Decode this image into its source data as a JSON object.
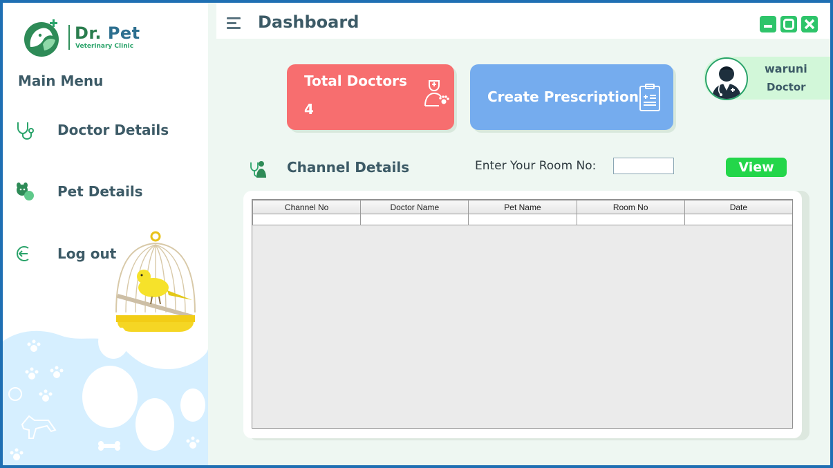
{
  "app": {
    "logo_title_1": "Dr.",
    "logo_title_2": "Pet",
    "logo_subtitle": "Veterinary Clinic"
  },
  "sidebar": {
    "heading": "Main Menu",
    "items": [
      {
        "label": "Doctor Details",
        "icon": "stethoscope-icon"
      },
      {
        "label": "Pet Details",
        "icon": "pets-icon"
      },
      {
        "label": "Log out",
        "icon": "logout-icon"
      }
    ]
  },
  "header": {
    "title": "Dashboard",
    "window_controls": [
      "minimize",
      "maximize",
      "close"
    ]
  },
  "cards": {
    "doctors": {
      "title": "Total Doctors",
      "value": "4",
      "icon": "vet-doctor-icon",
      "color": "#f76e6f"
    },
    "prescription": {
      "title": "Create Prescription",
      "icon": "clipboard-icon",
      "color": "#75acee"
    }
  },
  "user": {
    "name": "waruni",
    "role": "Doctor",
    "avatar_icon": "doctor-avatar-icon"
  },
  "channel": {
    "title": "Channel Details",
    "room_label": "Enter Your Room No:",
    "room_value": "",
    "view_label": "View",
    "columns": [
      "Channel No",
      "Doctor Name",
      "Pet Name",
      "Room No",
      "Date"
    ],
    "rows": [
      [
        "",
        "",
        "",
        "",
        ""
      ]
    ]
  },
  "colors": {
    "accent_green": "#2ec46a",
    "view_button": "#23d64a",
    "text_dark": "#3c5a66"
  }
}
